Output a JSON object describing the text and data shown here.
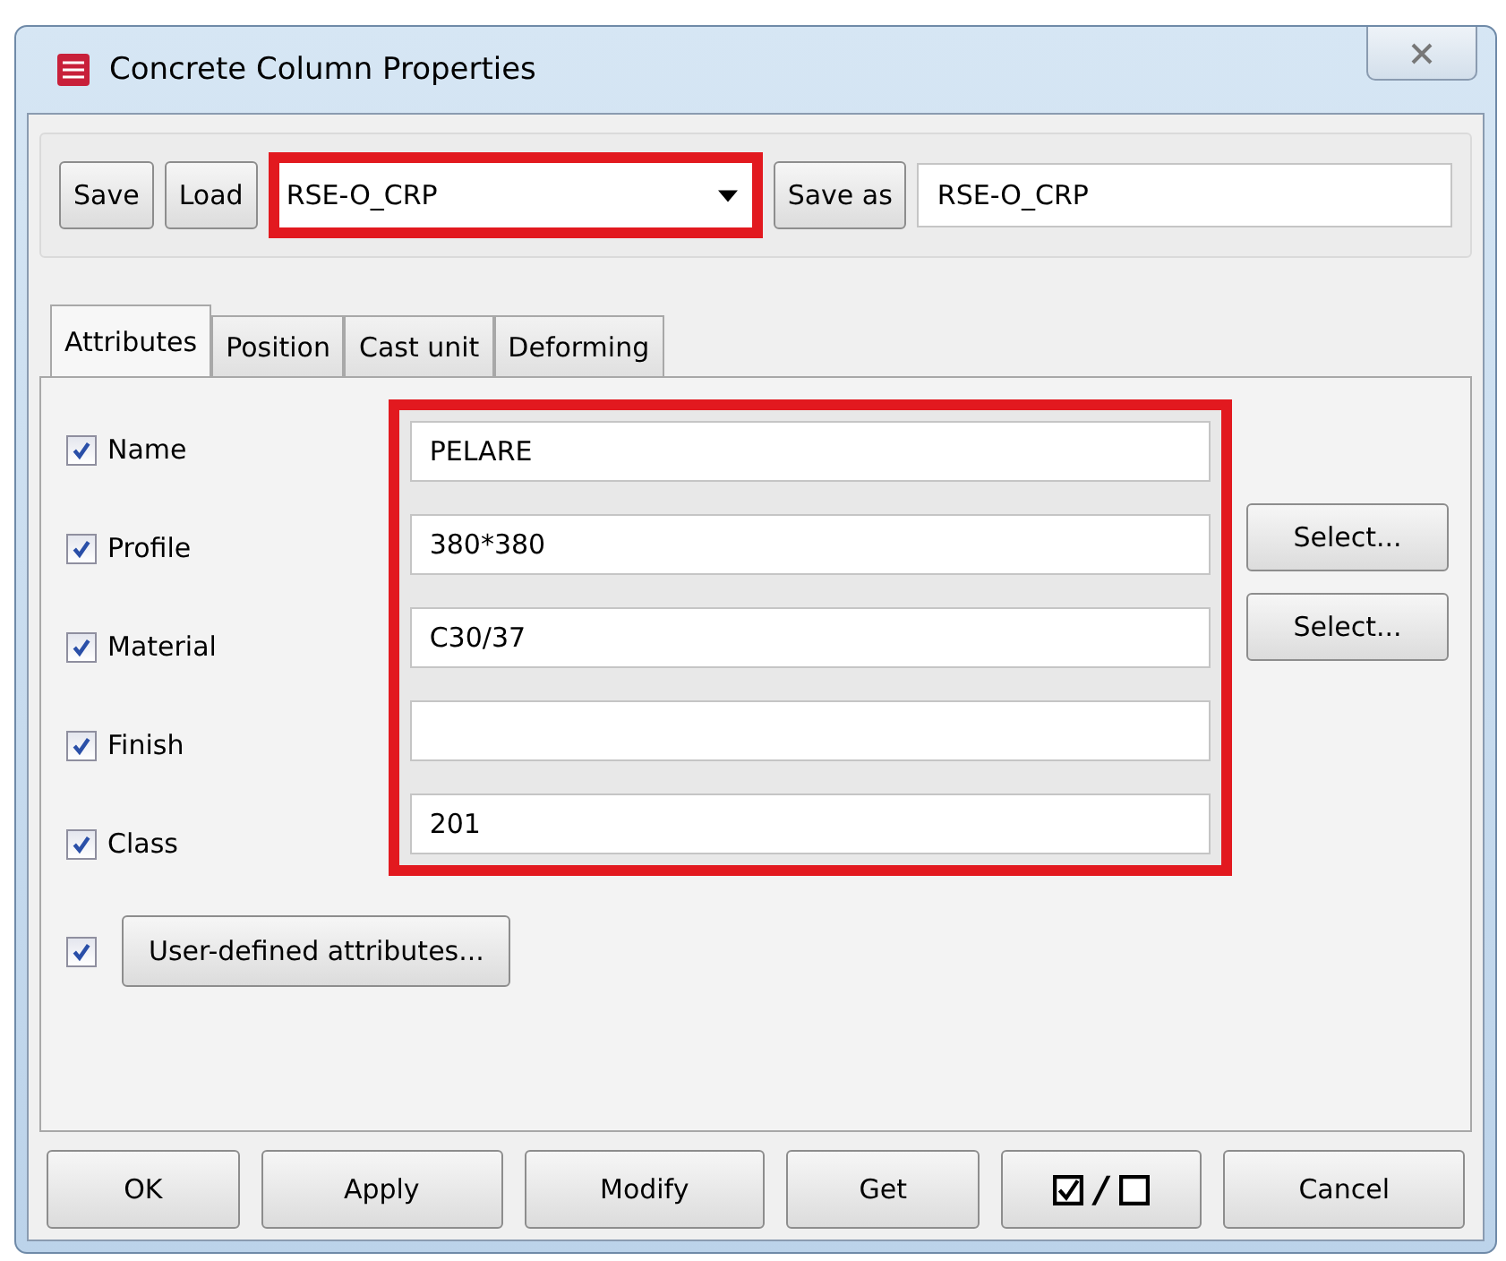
{
  "window": {
    "title": "Concrete Column Properties"
  },
  "toolbar": {
    "save": "Save",
    "load": "Load",
    "preset": "RSE-O_CRP",
    "save_as": "Save as",
    "save_as_name": "RSE-O_CRP"
  },
  "tabs": [
    {
      "label": "Attributes",
      "selected": true
    },
    {
      "label": "Position",
      "selected": false
    },
    {
      "label": "Cast unit",
      "selected": false
    },
    {
      "label": "Deforming",
      "selected": false
    }
  ],
  "attributes": [
    {
      "label": "Name",
      "checked": true,
      "value": "PELARE"
    },
    {
      "label": "Profile",
      "checked": true,
      "value": "380*380",
      "select": "Select..."
    },
    {
      "label": "Material",
      "checked": true,
      "value": "C30/37",
      "select": "Select..."
    },
    {
      "label": "Finish",
      "checked": true
    },
    {
      "label": "Class",
      "checked": true,
      "value": "201"
    }
  ],
  "user_defined": {
    "checked": true,
    "label": "User-defined attributes..."
  },
  "buttons": {
    "ok": "OK",
    "apply": "Apply",
    "modify": "Modify",
    "get": "Get",
    "toggle_separator": "/",
    "cancel": "Cancel"
  }
}
